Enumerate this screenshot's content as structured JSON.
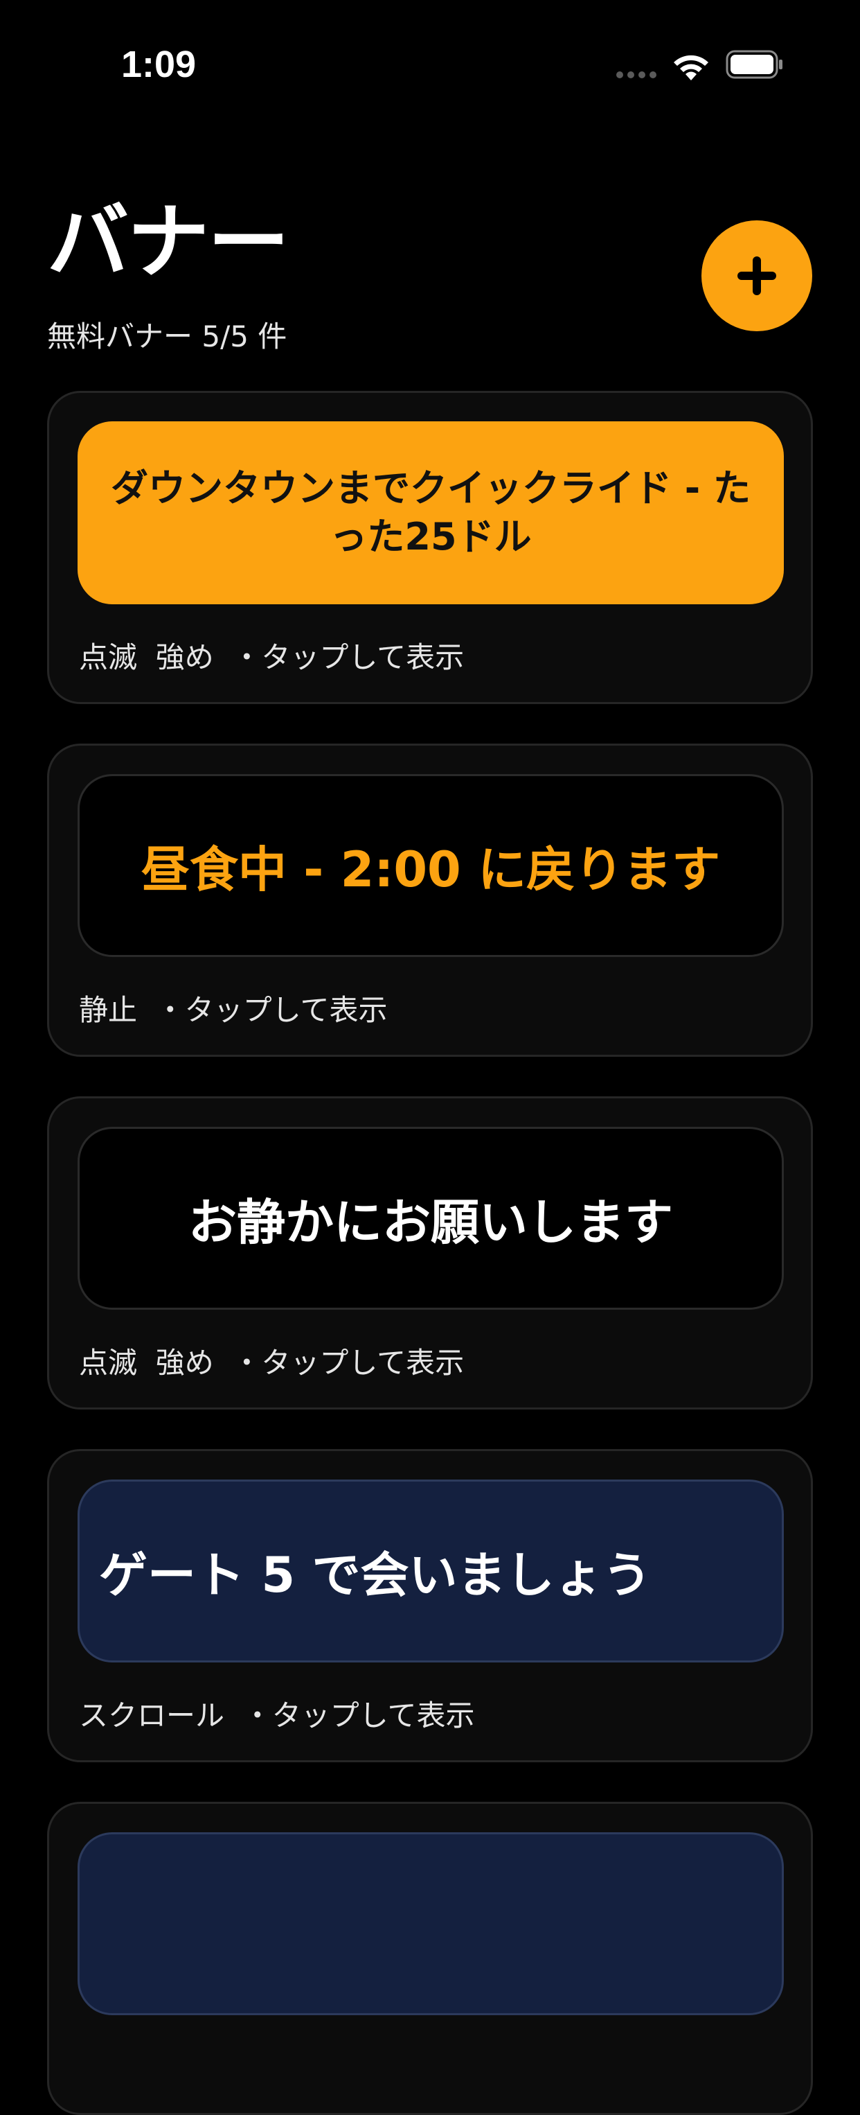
{
  "status_bar": {
    "time": "1:09"
  },
  "header": {
    "title": "バナー",
    "subtitle": "無料バナー 5/5 件",
    "add_button_icon": "plus-icon"
  },
  "colors": {
    "accent": "#fca311",
    "background": "#000000",
    "card_background": "#0c0c0c",
    "navy_banner": "#14203f"
  },
  "banners": [
    {
      "text": "ダウンタウンまでクイックライド - たった25ドル",
      "meta": "点滅  強め  ・タップして表示"
    },
    {
      "text": "昼食中 - 2:00 に戻ります",
      "meta": "静止  ・タップして表示"
    },
    {
      "text": "お静かにお願いします",
      "meta": "点滅  強め  ・タップして表示"
    },
    {
      "text": "ゲート 5 で会いましょう",
      "meta": "スクロール  ・タップして表示"
    }
  ]
}
